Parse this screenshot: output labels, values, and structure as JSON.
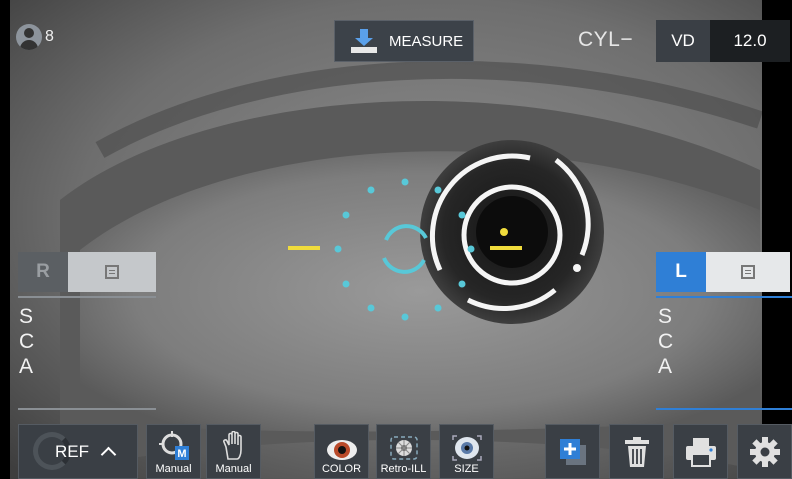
{
  "header": {
    "user_count": "8",
    "measure_label": "MEASURE",
    "cyl_label": "CYL−",
    "vd_label": "VD",
    "vd_value": "12.0"
  },
  "left_eye_panel": {
    "tab_label": "R",
    "rows": [
      "S",
      "C",
      "A"
    ]
  },
  "right_eye_panel": {
    "tab_label": "L",
    "rows": [
      "S",
      "C",
      "A"
    ]
  },
  "toolbar": {
    "ref_label": "REF",
    "manual_focus_label": "Manual",
    "manual_hand_label": "Manual",
    "color_label": "COLOR",
    "retro_label": "Retro-ILL",
    "size_label": "SIZE",
    "manual_badge": "M"
  },
  "colors": {
    "accent_blue": "#2f7fd6",
    "target_cyan": "#58c8d8",
    "marker_yellow": "#f0dc3c",
    "button_gray": "#3a3f45"
  },
  "icons": [
    "user-icon",
    "measure-download-icon",
    "list-icon",
    "focus-target-icon",
    "hand-icon",
    "eye-color-icon",
    "retro-ill-icon",
    "size-eye-icon",
    "add-copy-icon",
    "trash-icon",
    "printer-icon",
    "gear-icon"
  ]
}
